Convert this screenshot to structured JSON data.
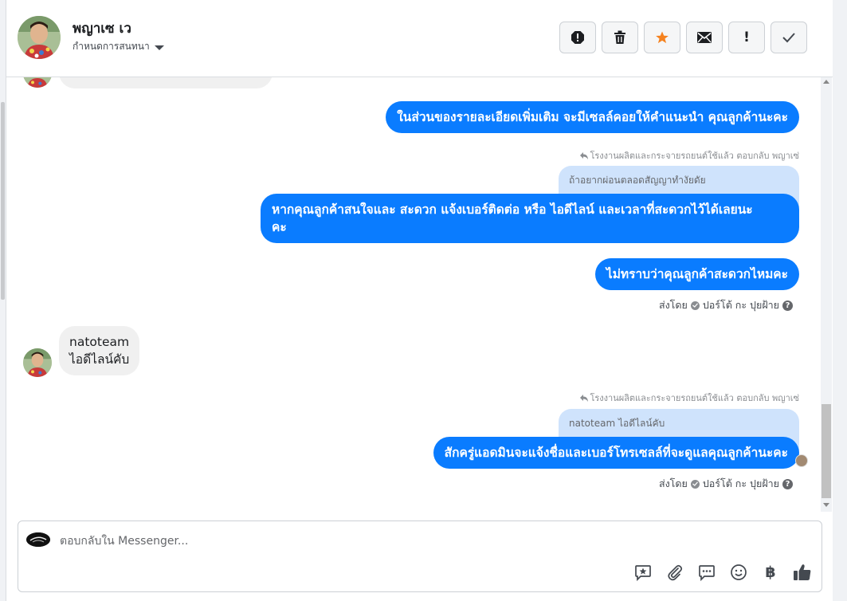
{
  "header": {
    "contact_name": "พญาเซ เว",
    "assign_label": "กำหนดการสนทนา",
    "actions": [
      "spam-icon",
      "trash-icon",
      "star-icon",
      "mail-icon",
      "exclamation-icon",
      "check-icon"
    ],
    "action_text": {
      "exclamation": "!"
    }
  },
  "messages": {
    "m1": "ในส่วนของรายละเอียดเพิ่มเติม จะมีเซลล์คอยให้คำแนะนำ คุณลูกค้านะคะ",
    "reply1_note": "โรงงานผลิตและกระจายรถยนต์ใช้แล้ว ตอบกลับ พญาเซ่",
    "quote1": "ถ้าอยากผ่อนตลอดสัญญาทำงัยดัย",
    "m2_line1": "หากคุณลูกค้าสนใจและ สะดวก แจ้งเบอร์ติดต่อ หรือ ไอดีไลน์ และเวลาที่สะดวกไว้ได้เลยนะ",
    "m2_line2": "คะ",
    "m3": "ไม่ทราบว่าคุณลูกค้าสะดวกไหมคะ",
    "sent_by1": "ส่งโดย",
    "sender1": "ปอร์โต้ กะ ปุยฝ้าย",
    "in_line1": "natoteam",
    "in_line2": "ไอดีไลน์คับ",
    "reply2_note": "โรงงานผลิตและกระจายรถยนต์ใช้แล้ว ตอบกลับ พญาเซ่",
    "quote2": "natoteam ไอดีไลน์คับ",
    "m4": "สักครู่แอดมินจะแจ้งชื่อและเบอร์โทรเซลล์ที่จะดูแลคุณลูกค้านะคะ",
    "sent_by2": "ส่งโดย",
    "sender2": "ปอร์โต้ กะ ปุยฝ้าย"
  },
  "composer": {
    "placeholder": "ตอบกลับใน Messenger...",
    "tools": [
      "saved-reply-icon",
      "attachment-icon",
      "chat-icon",
      "emoji-icon",
      "baht-icon",
      "like-icon"
    ],
    "baht_symbol": "฿"
  },
  "colors": {
    "outgoing": "#0a7cff",
    "incoming": "#f0f0f0",
    "quote": "#cfe3fc",
    "star": "#f5821f"
  }
}
